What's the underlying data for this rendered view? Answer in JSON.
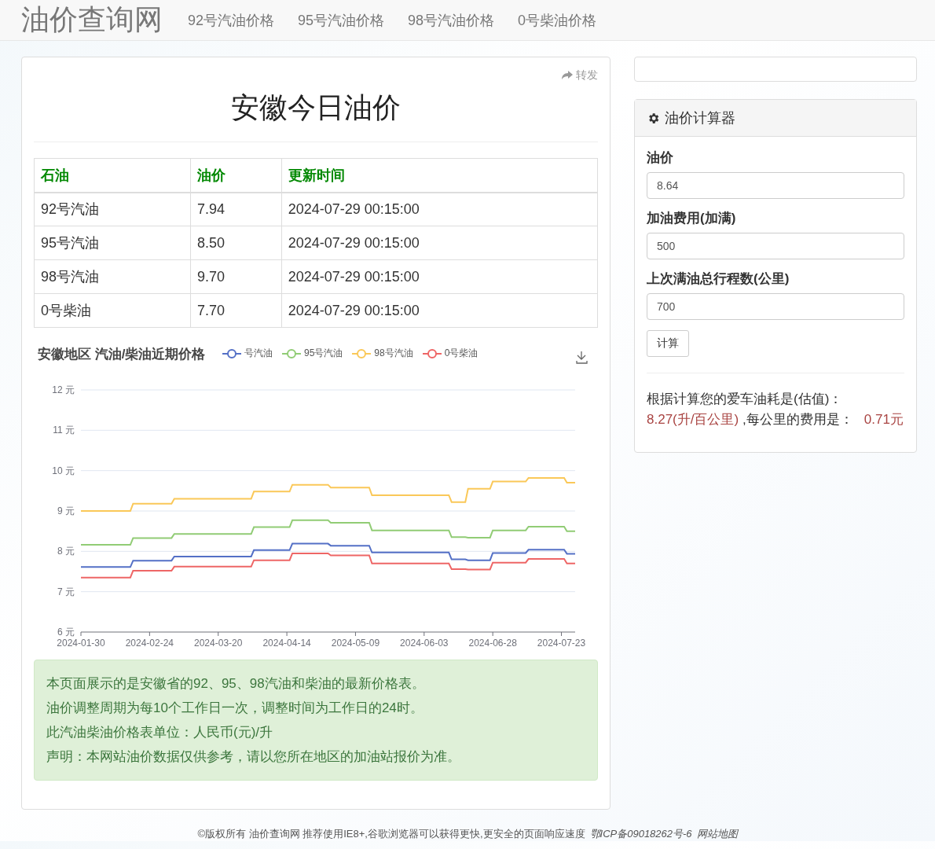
{
  "navbar": {
    "brand": "油价查询网",
    "links": [
      "92号汽油价格",
      "95号汽油价格",
      "98号汽油价格",
      "0号柴油价格"
    ]
  },
  "share": {
    "label": "转发"
  },
  "title": "安徽今日油价",
  "table": {
    "columns": [
      "石油",
      "油价",
      "更新时间"
    ],
    "rows": [
      [
        "92号汽油",
        "7.94",
        "2024-07-29 00:15:00"
      ],
      [
        "95号汽油",
        "8.50",
        "2024-07-29 00:15:00"
      ],
      [
        "98号汽油",
        "9.70",
        "2024-07-29 00:15:00"
      ],
      [
        "0号柴油",
        "7.70",
        "2024-07-29 00:15:00"
      ]
    ]
  },
  "chart": {
    "chart_data": {
      "type": "line",
      "title": "安徽地区 汽油/柴油近期价格",
      "x": [
        "2024-01-30",
        "2024-02-17",
        "2024-02-18",
        "2024-03-03",
        "2024-03-04",
        "2024-04-01",
        "2024-04-02",
        "2024-04-15",
        "2024-04-16",
        "2024-04-29",
        "2024-04-30",
        "2024-05-14",
        "2024-05-15",
        "2024-06-12",
        "2024-06-13",
        "2024-06-18",
        "2024-06-19",
        "2024-06-27",
        "2024-06-28",
        "2024-07-10",
        "2024-07-11",
        "2024-07-24",
        "2024-07-25",
        "2024-07-28"
      ],
      "xlim": [
        "2024-01-30",
        "2024-07-28"
      ],
      "grid": true,
      "legend": true,
      "series": [
        {
          "name": "号汽油",
          "color": "#5470c6",
          "values": [
            7.61,
            7.61,
            7.77,
            7.77,
            7.87,
            7.87,
            8.03,
            8.03,
            8.19,
            8.19,
            8.14,
            8.14,
            7.97,
            7.97,
            7.8,
            7.8,
            7.78,
            7.78,
            7.96,
            7.96,
            8.04,
            8.04,
            7.94,
            7.94
          ]
        },
        {
          "name": "95号汽油",
          "color": "#91cc75",
          "values": [
            8.16,
            8.16,
            8.33,
            8.33,
            8.43,
            8.43,
            8.6,
            8.6,
            8.77,
            8.77,
            8.71,
            8.71,
            8.52,
            8.52,
            8.35,
            8.35,
            8.34,
            8.34,
            8.52,
            8.52,
            8.61,
            8.61,
            8.5,
            8.5
          ]
        },
        {
          "name": "98号汽油",
          "color": "#fac858",
          "values": [
            9.0,
            9.0,
            9.18,
            9.18,
            9.3,
            9.3,
            9.48,
            9.48,
            9.65,
            9.65,
            9.58,
            9.58,
            9.39,
            9.39,
            9.22,
            9.22,
            9.55,
            9.55,
            9.73,
            9.73,
            9.82,
            9.82,
            9.7,
            9.7
          ]
        },
        {
          "name": "0号柴油",
          "color": "#ee6666",
          "values": [
            7.35,
            7.35,
            7.52,
            7.52,
            7.62,
            7.62,
            7.78,
            7.78,
            7.95,
            7.95,
            7.9,
            7.9,
            7.7,
            7.7,
            7.56,
            7.56,
            7.55,
            7.55,
            7.72,
            7.72,
            7.81,
            7.81,
            7.7,
            7.7
          ]
        }
      ],
      "ylim": [
        6,
        12
      ],
      "yticks": [
        {
          "value": 6,
          "label": "6 元"
        },
        {
          "value": 7,
          "label": "7 元"
        },
        {
          "value": 8,
          "label": "8 元"
        },
        {
          "value": 9,
          "label": "9 元"
        },
        {
          "value": 10,
          "label": "10 元"
        },
        {
          "value": 11,
          "label": "11 元"
        },
        {
          "value": 12,
          "label": "12 元"
        }
      ],
      "xticks": [
        "2024-01-30",
        "2024-02-24",
        "2024-03-20",
        "2024-04-14",
        "2024-05-09",
        "2024-06-03",
        "2024-06-28",
        "2024-07-23"
      ]
    }
  },
  "notice": [
    "本页面展示的是安徽省的92、95、98汽油和柴油的最新价格表。",
    "油价调整周期为每10个工作日一次，调整时间为工作日的24时。",
    "此汽油柴油价格表单位：人民币(元)/升",
    "声明：本网站油价数据仅供参考，请以您所在地区的加油站报价为准。"
  ],
  "calculator": {
    "title": "油价计算器",
    "fields": [
      {
        "label": "油价",
        "value": "8.64"
      },
      {
        "label": "加油费用(加满)",
        "value": "500"
      },
      {
        "label": "上次满油总行程数(公里)",
        "value": "700"
      }
    ],
    "button": "计算",
    "result": {
      "intro": "根据计算您的爱车油耗是(估值)：",
      "consumption": "8.27(升/百公里)",
      "mid": ",每公里的费用是：",
      "cost": "0.71元"
    }
  },
  "footer": {
    "text": "©版权所有 油价查询网 推荐使用IE8+,谷歌浏览器可以获得更快,更安全的页面响应速度",
    "icp": "鄂ICP备09018262号-6",
    "sitemap": "网站地图"
  }
}
